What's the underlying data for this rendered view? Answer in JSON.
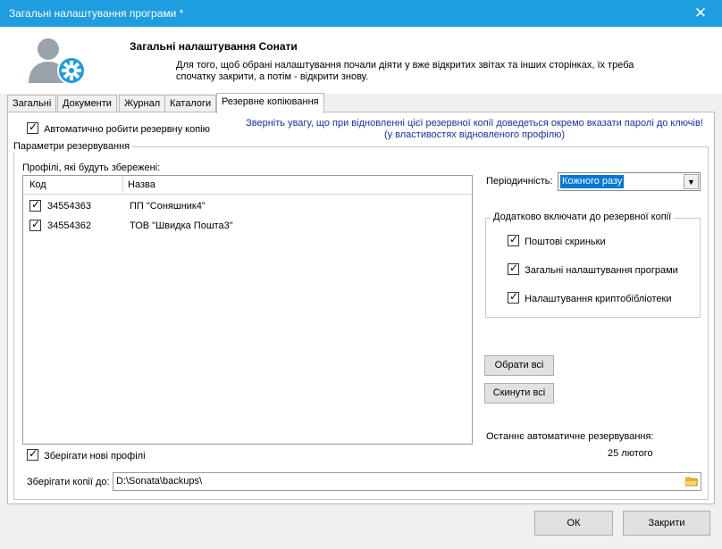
{
  "window": {
    "title": "Загальні налаштування програми *"
  },
  "header": {
    "title": "Загальні налаштування Сонати",
    "description": "Для того, щоб обрані налаштування почали діяти у вже відкритих звітах та інших сторінках, їх треба спочатку закрити, а потім - відкрити знову."
  },
  "tabs": [
    "Загальні",
    "Документи",
    "Журнал",
    "Каталоги",
    "Резервне копіювання"
  ],
  "backup": {
    "auto_backup_label": "Автоматично робити резервну копію",
    "notice_line1": "Зверніть увагу, що при відновленні цієї резервної копії доведеться окремо вказати паролі до ключів!",
    "notice_line2": "(у властивостях відновленого профілю)",
    "params_legend": "Параметри резервування",
    "profiles_caption": "Профілі, які будуть збережені:",
    "grid": {
      "columns": [
        "Код",
        "Назва"
      ],
      "rows": [
        {
          "code": "34554363",
          "name": "ПП \"Соняшник4\"",
          "checked": true
        },
        {
          "code": "34554362",
          "name": "ТОВ \"Швидка Пошта3\"",
          "checked": true
        }
      ]
    },
    "periodicity_label": "Періодичність:",
    "periodicity_value": "Кожного разу",
    "extra_legend": "Додатково включати до резервної копії",
    "extra_items": [
      "Поштові скриньки",
      "Загальні налаштування програми",
      "Налаштування криптобібліотеки"
    ],
    "select_all_label": "Обрати всі",
    "reset_all_label": "Скинути всі",
    "last_backup_label": "Останнє автоматичне резервування:",
    "last_backup_value": "25 лютого",
    "save_new_profiles_label": "Зберігати нові профілі",
    "save_to_label": "Зберігати копії до:",
    "save_to_path": "D:\\Sonata\\backups\\"
  },
  "footer": {
    "ok_label": "ОК",
    "close_label": "Закрити"
  },
  "colors": {
    "titlebar": "#1e9de0",
    "accent": "#0078d7",
    "notice": "#1a2fa8",
    "gear": "#1e9de0",
    "folder": "#f5c342"
  }
}
